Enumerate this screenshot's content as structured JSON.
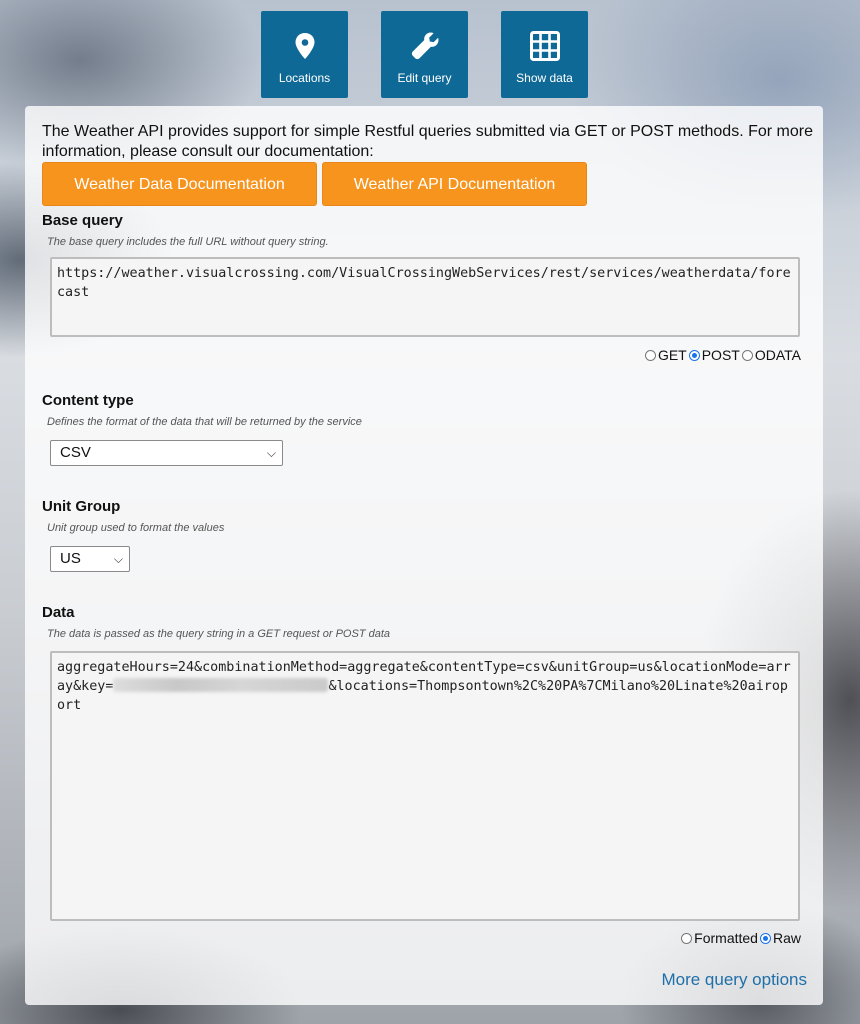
{
  "nav": {
    "locations": {
      "label": "Locations",
      "icon": "map-pin-icon"
    },
    "edit_query": {
      "label": "Edit query",
      "icon": "wrench-icon"
    },
    "show_data": {
      "label": "Show data",
      "icon": "grid-icon"
    }
  },
  "intro": {
    "text": "The Weather API provides support for simple Restful queries submitted via GET or POST methods. For more information, please consult our documentation:"
  },
  "doc_buttons": {
    "data_doc": "Weather Data Documentation",
    "api_doc": "Weather API Documentation"
  },
  "base_query": {
    "title": "Base query",
    "description": "The base query includes the full URL without query string.",
    "value": "https://weather.visualcrossing.com/VisualCrossingWebServices/rest/services/weatherdata/forecast",
    "methods": [
      {
        "label": "GET",
        "checked": false
      },
      {
        "label": "POST",
        "checked": true
      },
      {
        "label": "ODATA",
        "checked": false
      }
    ]
  },
  "content_type": {
    "title": "Content type",
    "description": "Defines the format of the data that will be returned by the service",
    "selected": "CSV"
  },
  "unit_group": {
    "title": "Unit Group",
    "description": "Unit group used to format the values",
    "selected": "US"
  },
  "data": {
    "title": "Data",
    "description": "The data is passed as the query string in a GET request or POST data",
    "value_before_key": "aggregateHours=24&combinationMethod=aggregate&contentType=csv&unitGroup=us&locationMode=array&key=",
    "value_after_key": "&locations=Thompsontown%2C%20PA%7CMilano%20Linate%20airoport",
    "formats": [
      {
        "label": "Formatted",
        "checked": false
      },
      {
        "label": "Raw",
        "checked": true
      }
    ]
  },
  "more_options": "More query options",
  "colors": {
    "nav_blue": "#0f6996",
    "doc_orange": "#f7941d",
    "link_blue": "#1f6fa8"
  }
}
